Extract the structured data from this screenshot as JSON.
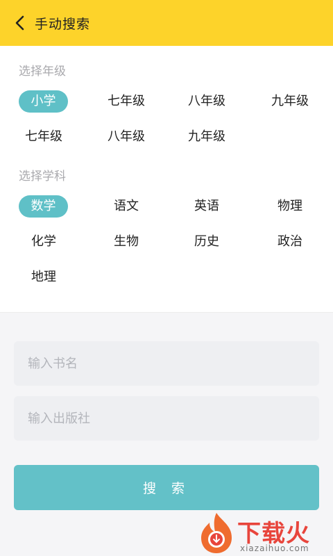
{
  "header": {
    "title": "手动搜索"
  },
  "grade_section": {
    "label": "选择年级",
    "options": [
      "小学",
      "七年级",
      "八年级",
      "九年级",
      "七年级",
      "八年级",
      "九年级"
    ],
    "selected": "小学"
  },
  "subject_section": {
    "label": "选择学科",
    "options": [
      "数学",
      "语文",
      "英语",
      "物理",
      "化学",
      "生物",
      "历史",
      "政治",
      "地理"
    ],
    "selected": "数学"
  },
  "form": {
    "book_name_placeholder": "输入书名",
    "publisher_placeholder": "输入出版社",
    "search_label": "搜 索"
  },
  "watermark": {
    "brand": "下载火",
    "url": "xiazaihuo.com"
  },
  "colors": {
    "header_bg": "#fdd32a",
    "accent": "#5fc0c7",
    "button_bg": "#63c1c8",
    "watermark_red": "#e8453c"
  }
}
